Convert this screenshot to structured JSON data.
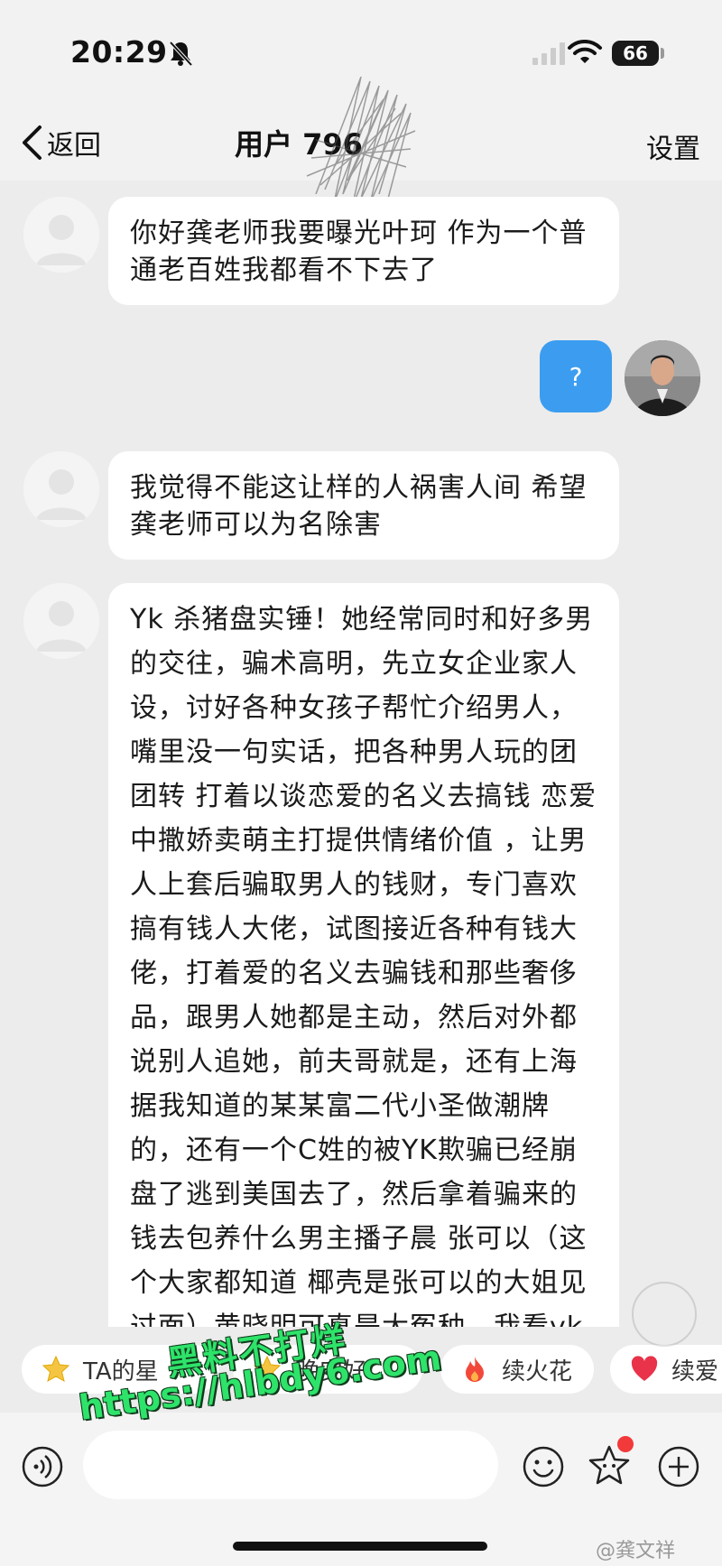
{
  "status_bar": {
    "time": "20:29",
    "battery": "66"
  },
  "nav": {
    "back_label": "返回",
    "title": "用户 796",
    "settings_label": "设置"
  },
  "messages": [
    {
      "side": "in",
      "text": "你好龚老师我要曝光叶珂 作为一个普通老百姓我都看不下去了"
    },
    {
      "side": "out",
      "text": "?"
    },
    {
      "side": "in",
      "text": "我觉得不能这让样的人祸害人间 希望龚老师可以为名除害"
    },
    {
      "side": "in",
      "text": "Yk 杀猪盘实锤！她经常同时和好多男的交往，骗术高明，先立女企业家人设，讨好各种女孩子帮忙介绍男人，嘴里没一句实话，把各种男人玩的团团转 打着以谈恋爱的名义去搞钱 恋爱中撒娇卖萌主打提供情绪价值 ，让男人上套后骗取男人的钱财，专门喜欢搞有钱人大佬，试图接近各种有钱大佬，打着爱的名义去骗钱和那些奢侈品，跟男人她都是主动，然后对外都说别人追她，前夫哥就是，还有上海据我知道的某某富二代小圣做潮牌的，还有一个C姓的被YK欺骗已经崩盘了逃到美国去了，然后拿着骗来的钱去包养什么男主播子晨 张可以（这个大家都知道 椰壳是张可以的大姐见过面）黄晓明可真是大冤种，我看yk晒的给她买了几百万的钻石，"
    }
  ],
  "chips": [
    {
      "label": "TA的星",
      "icon": "star-icon"
    },
    {
      "label": "晚安好",
      "icon": "star-icon"
    },
    {
      "label": "续火花",
      "icon": "fire-icon"
    },
    {
      "label": "续爱",
      "icon": "heart-icon"
    }
  ],
  "watermarks": {
    "cn": "黑料不打烊",
    "url": "https://hlbdy6.com",
    "weibo": "@龚文祥"
  },
  "colors": {
    "out_bubble": "#3c9df0",
    "background": "#ececec",
    "watermark": "#2ee36a",
    "badge": "#f23a3a"
  }
}
